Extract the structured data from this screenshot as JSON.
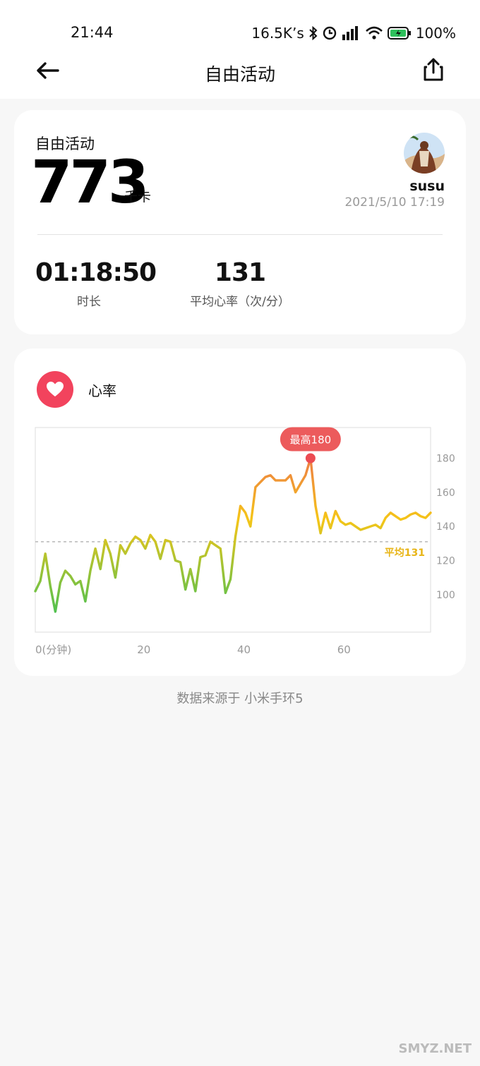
{
  "status_bar": {
    "time": "21:44",
    "net_speed": "16.5K’s",
    "battery": "100%",
    "icons": [
      "bluetooth-icon",
      "alarm-icon",
      "signal-icon",
      "wifi-icon",
      "battery-icon"
    ]
  },
  "nav": {
    "title": "自由活动",
    "back_icon": "arrow-left-icon",
    "share_icon": "share-icon"
  },
  "summary": {
    "activity_label": "自由活动",
    "calories": "773",
    "calories_unit": "千卡",
    "username": "susu",
    "datetime": "2021/5/10 17:19",
    "duration": "01:18:50",
    "duration_label": "时长",
    "avg_hr": "131",
    "avg_hr_label": "平均心率（次/分）"
  },
  "heart_rate": {
    "title": "心率",
    "icon": "heart-icon",
    "max_label": "最高180",
    "avg_label": "平均131"
  },
  "chart_data": {
    "type": "line",
    "x_tick_labels": [
      "0(分钟)",
      "20",
      "40",
      "60"
    ],
    "x_ticks": [
      0,
      20,
      40,
      60
    ],
    "y_ticks": [
      100,
      120,
      140,
      160,
      180
    ],
    "xlim": [
      0,
      79
    ],
    "ylim": [
      78,
      198
    ],
    "avg": 131,
    "max": 180,
    "series": [
      {
        "x": [
          0,
          1,
          2,
          3,
          4,
          5,
          6,
          7,
          8,
          9,
          10,
          11,
          12,
          13,
          14,
          15,
          16,
          17,
          18,
          19,
          20,
          21,
          22,
          23,
          24,
          25,
          26,
          27,
          28,
          29,
          30,
          31,
          32,
          33,
          34,
          35,
          36,
          37,
          38,
          39,
          40,
          41,
          42,
          43,
          44,
          45,
          46,
          47,
          48,
          49,
          50,
          51,
          52,
          53,
          54,
          55,
          56,
          57,
          58,
          59,
          60,
          61,
          62,
          63,
          64,
          65,
          66,
          67,
          68,
          69,
          70,
          71,
          72,
          73,
          74,
          75,
          76,
          77,
          78,
          79
        ],
        "y": [
          102,
          108,
          124,
          105,
          90,
          107,
          114,
          111,
          106,
          108,
          96,
          114,
          127,
          115,
          132,
          124,
          110,
          129,
          124,
          130,
          134,
          132,
          127,
          135,
          131,
          121,
          132,
          131,
          120,
          119,
          103,
          115,
          102,
          122,
          123,
          131,
          129,
          127,
          101,
          109,
          134,
          152,
          148,
          140,
          163,
          166,
          169,
          170,
          167,
          167,
          167,
          170,
          160,
          165,
          170,
          180,
          152,
          136,
          148,
          139,
          149,
          143,
          141,
          142,
          140,
          138,
          139,
          140,
          141,
          139,
          145,
          148,
          146,
          144,
          145,
          147,
          148,
          146,
          145,
          148
        ],
        "colors": {
          "low": "#2ec05c",
          "mid": "#f5c518",
          "high": "#e9585c"
        }
      }
    ],
    "grid": false
  },
  "footer": {
    "source": "数据来源于 小米手环5",
    "watermark": "SMYZ.NET"
  }
}
